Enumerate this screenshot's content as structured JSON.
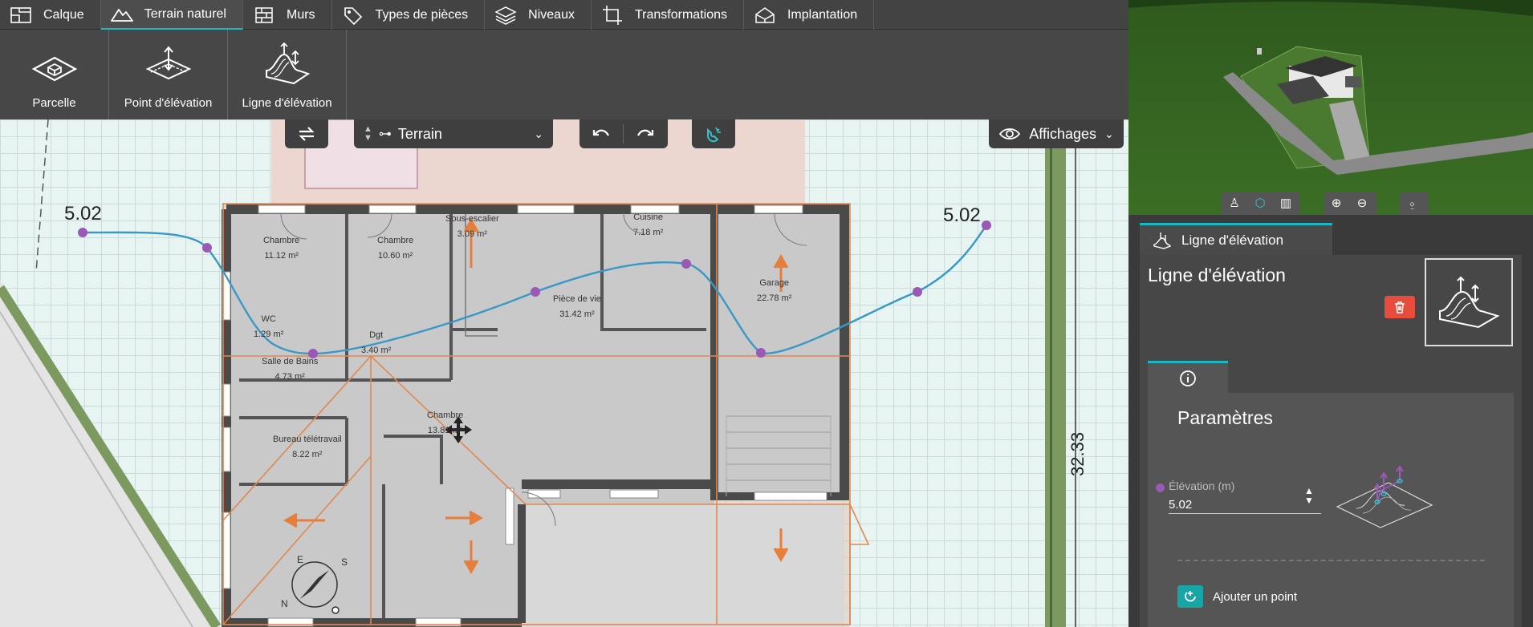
{
  "tabs": [
    {
      "label": "Calque",
      "icon": "layer-plan-icon",
      "active": false
    },
    {
      "label": "Terrain naturel",
      "icon": "mountain-icon",
      "active": true
    },
    {
      "label": "Murs",
      "icon": "brick-wall-icon",
      "active": false
    },
    {
      "label": "Types de pièces",
      "icon": "tag-icon",
      "active": false
    },
    {
      "label": "Niveaux",
      "icon": "layers-stack-icon",
      "active": false
    },
    {
      "label": "Transformations",
      "icon": "crop-transform-icon",
      "active": false
    },
    {
      "label": "Implantation",
      "icon": "house-3d-icon",
      "active": false
    }
  ],
  "ribbon": {
    "parcelle": "Parcelle",
    "point": "Point d'élévation",
    "ligne": "Ligne d'élévation"
  },
  "toolbar": {
    "level_select": "Terrain",
    "affichages": "Affichages"
  },
  "plan": {
    "elev_left": "5.02",
    "elev_right": "5.02",
    "dimension": "32.33",
    "rooms": [
      {
        "name": "Chambre",
        "area": "11.12 m²"
      },
      {
        "name": "Chambre",
        "area": "10.60 m²"
      },
      {
        "name": "Sous-escalier",
        "area": "3.09 m²"
      },
      {
        "name": "Cuisine",
        "area": "7.18 m²"
      },
      {
        "name": "Garage",
        "area": "22.78 m²"
      },
      {
        "name": "Pièce de vie",
        "area": "31.42 m²"
      },
      {
        "name": "WC",
        "area": "1.29 m²"
      },
      {
        "name": "Dgt",
        "area": "3.40 m²"
      },
      {
        "name": "Salle de Bains",
        "area": "4.73 m²"
      },
      {
        "name": "Chambre",
        "area": "13.81 m²"
      },
      {
        "name": "Bureau télétravail",
        "area": "8.22 m²"
      }
    ],
    "compass": {
      "n": "N",
      "s": "S",
      "e": "E"
    }
  },
  "view3d_tools": [
    "person-view-icon",
    "3d-view-icon",
    "plan-view-icon",
    "zoom-in-icon",
    "zoom-out-icon",
    "mouse-icon"
  ],
  "panel": {
    "tab_label": "Ligne d'élévation",
    "title": "Ligne d'élévation",
    "section": "Paramètres",
    "field_label": "Élévation (m)",
    "field_value": "5.02",
    "add_point": "Ajouter un point"
  },
  "colors": {
    "accent": "#1fb6c2",
    "curve": "#3a98c6",
    "point": "#9b59b6",
    "delete": "#e74c3c",
    "arrow": "#e67e3c"
  }
}
